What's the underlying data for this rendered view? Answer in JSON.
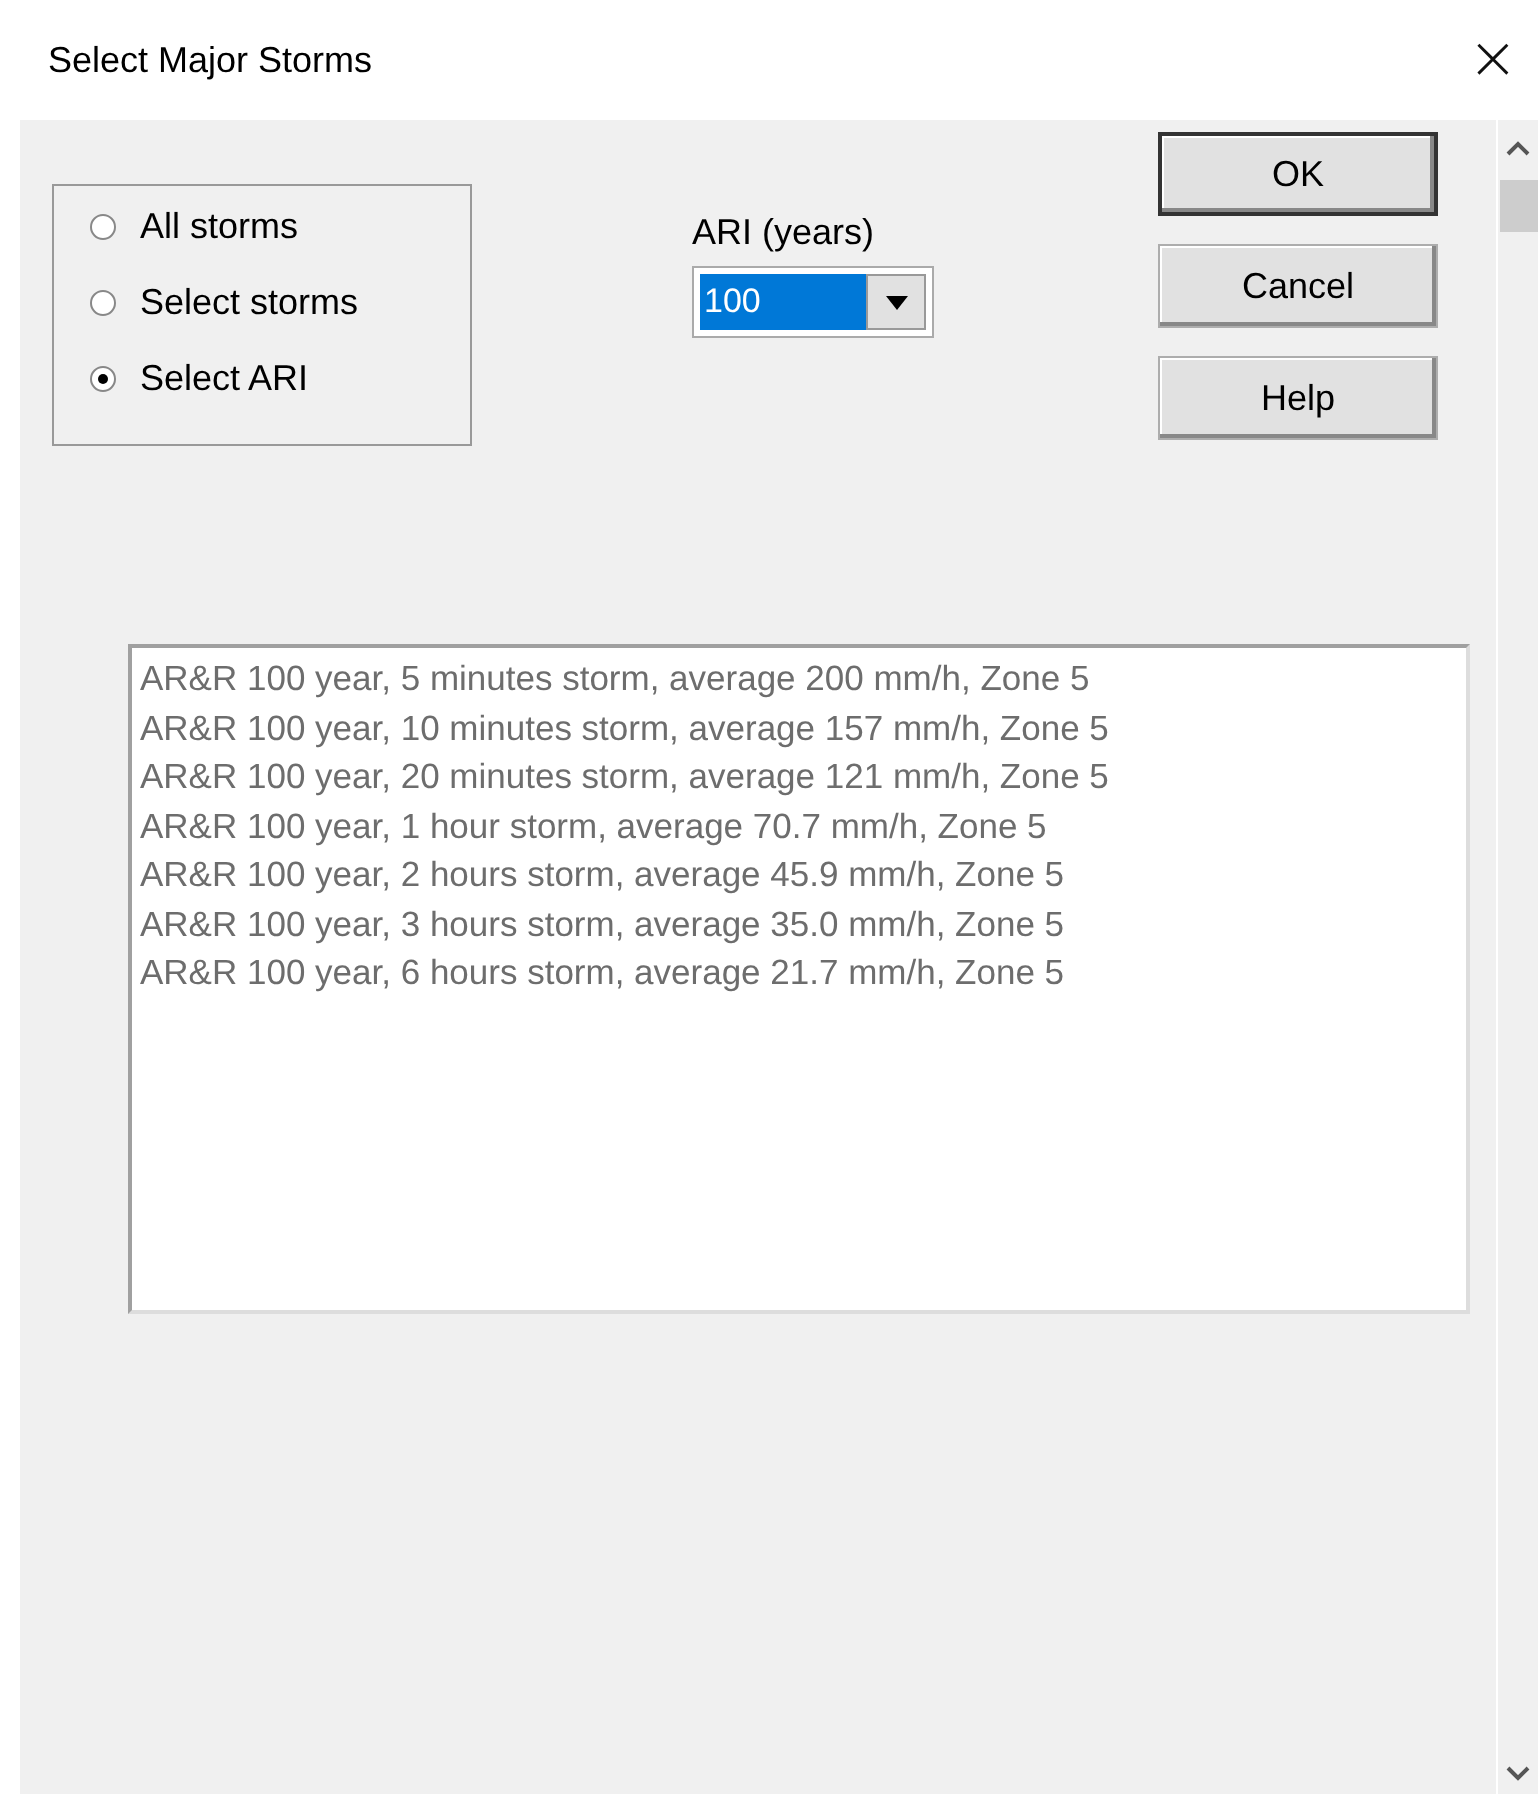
{
  "window": {
    "title": "Select Major Storms",
    "close": "×"
  },
  "storm_options": [
    {
      "label": "All storms",
      "selected": false
    },
    {
      "label": "Select storms",
      "selected": false
    },
    {
      "label": "Select ARI",
      "selected": true
    }
  ],
  "ari": {
    "label": "ARI (years)",
    "value": "100"
  },
  "buttons": [
    "OK",
    "Cancel",
    "Help"
  ],
  "storms": [
    "AR&R 100 year, 5 minutes storm, average 200 mm/h, Zone 5",
    "AR&R 100 year, 10 minutes storm, average 157 mm/h, Zone 5",
    "AR&R 100 year, 20 minutes storm, average 121 mm/h, Zone 5",
    "AR&R 100 year, 1 hour storm, average 70.7 mm/h, Zone 5",
    "AR&R 100 year, 2 hours storm, average 45.9 mm/h, Zone 5",
    "AR&R 100 year, 3 hours storm, average 35.0 mm/h, Zone 5",
    "AR&R 100 year, 6 hours storm, average 21.7 mm/h, Zone 5"
  ]
}
